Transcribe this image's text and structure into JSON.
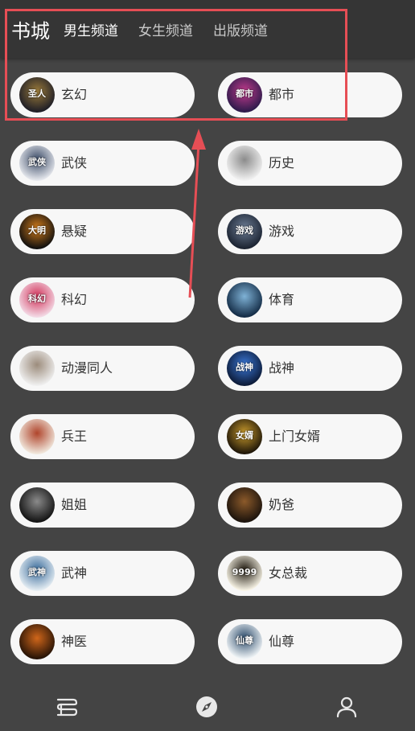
{
  "header": {
    "title": "书城",
    "tabs": [
      {
        "label": "男生频道",
        "active": true
      },
      {
        "label": "女生频道",
        "active": false
      },
      {
        "label": "出版频道",
        "active": false
      }
    ]
  },
  "status_colors": [
    "#e84c4c",
    "#29b3c9",
    "#29b3c9"
  ],
  "annotation": {
    "color": "#e64e55"
  },
  "categories": [
    {
      "label": "玄幻",
      "thumb_text": "圣人",
      "colors": [
        "#1c1c26",
        "#9a7a3a"
      ]
    },
    {
      "label": "都市",
      "thumb_text": "都市",
      "colors": [
        "#2b1a4a",
        "#c23a8c"
      ]
    },
    {
      "label": "武侠",
      "thumb_text": "武侠",
      "colors": [
        "#e7e9ee",
        "#3a4a66"
      ]
    },
    {
      "label": "历史",
      "thumb_text": "",
      "colors": [
        "#f2f2f2",
        "#8b8b8b"
      ]
    },
    {
      "label": "悬疑",
      "thumb_text": "大明",
      "colors": [
        "#0f0f0f",
        "#d07a1a"
      ]
    },
    {
      "label": "游戏",
      "thumb_text": "游戏",
      "colors": [
        "#1a2230",
        "#6c7c94"
      ]
    },
    {
      "label": "科幻",
      "thumb_text": "科幻",
      "colors": [
        "#f3dbe6",
        "#d2335a"
      ]
    },
    {
      "label": "体育",
      "thumb_text": "",
      "colors": [
        "#122a44",
        "#7fb2d6"
      ]
    },
    {
      "label": "动漫同人",
      "thumb_text": "",
      "colors": [
        "#f0f0f0",
        "#9c8c7c"
      ]
    },
    {
      "label": "战神",
      "thumb_text": "战神",
      "colors": [
        "#0c1a36",
        "#3a78d8"
      ]
    },
    {
      "label": "兵王",
      "thumb_text": "",
      "colors": [
        "#f1e9de",
        "#b0452c"
      ]
    },
    {
      "label": "上门女婿",
      "thumb_text": "女婿",
      "colors": [
        "#1c1408",
        "#c89a2c"
      ]
    },
    {
      "label": "姐姐",
      "thumb_text": "",
      "colors": [
        "#121212",
        "#8a8a8a"
      ]
    },
    {
      "label": "奶爸",
      "thumb_text": "",
      "colors": [
        "#1a120c",
        "#8c5a2a"
      ]
    },
    {
      "label": "武神",
      "thumb_text": "武神",
      "colors": [
        "#e6eef3",
        "#3a6c9c"
      ]
    },
    {
      "label": "女总裁",
      "thumb_text": "9999",
      "colors": [
        "#faf6e8",
        "#201a10"
      ]
    },
    {
      "label": "神医",
      "thumb_text": "",
      "colors": [
        "#241206",
        "#d0661a"
      ]
    },
    {
      "label": "仙尊",
      "thumb_text": "仙尊",
      "colors": [
        "#f2f6f8",
        "#2a4a6a"
      ]
    }
  ],
  "bottom_nav": [
    {
      "icon": "bookshelf-icon"
    },
    {
      "icon": "compass-icon",
      "active": true
    },
    {
      "icon": "user-icon"
    }
  ]
}
